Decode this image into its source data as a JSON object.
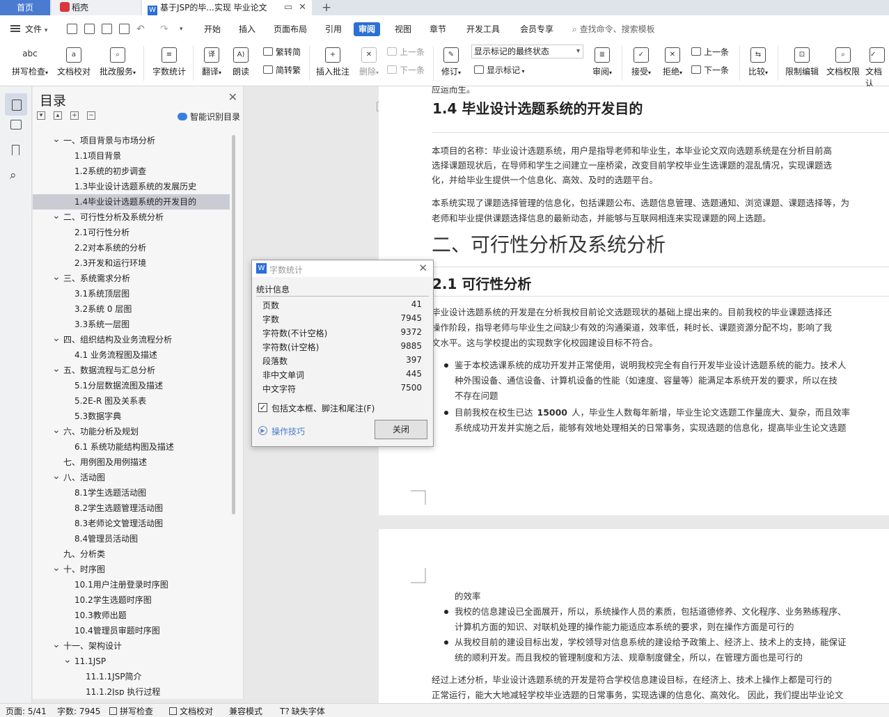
{
  "tabs": {
    "home": "首页",
    "daoke": "稻壳",
    "doc": "基于JSP的毕...实现 毕业论文",
    "add": "+"
  },
  "menu": {
    "file": "文件",
    "items": [
      "开始",
      "插入",
      "页面布局",
      "引用",
      "审阅",
      "视图",
      "章节",
      "开发工具",
      "会员专享"
    ],
    "active": "审阅",
    "search_placeholder": "查找命令、搜索模板"
  },
  "ribbon": {
    "spell_check": "拼写检查",
    "doc_proof": "文档校对",
    "revise_service": "批改服务",
    "word_count": "字数统计",
    "translate": "翻译",
    "read_aloud": "朗读",
    "trad_to_simp": "繁转简",
    "simp_to_trad": "简转繁",
    "insert_comment": "插入批注",
    "delete": "删除",
    "prev_comment": "上一条",
    "next_comment": "下一条",
    "track": "修订",
    "markup_mode": "显示标记的最终状态",
    "show_markup": "显示标记",
    "review": "审阅",
    "accept": "接受",
    "reject": "拒绝",
    "prev_change": "上一条",
    "next_change": "下一条",
    "compare": "比较",
    "restrict_edit": "限制编辑",
    "doc_permission": "文档权限",
    "doc_auth": "文档认"
  },
  "toc": {
    "title": "目录",
    "smart": "智能识别目录",
    "items": [
      {
        "label": "一、项目背景与市场分析",
        "level": 1,
        "caret": true
      },
      {
        "label": "1.1项目背景",
        "level": 2
      },
      {
        "label": "1.2系统的初步调查",
        "level": 2
      },
      {
        "label": "1.3毕业设计选题系统的发展历史",
        "level": 2
      },
      {
        "label": "1.4毕业设计选题系统的开发目的",
        "level": 2,
        "selected": true
      },
      {
        "label": "二、可行性分析及系统分析",
        "level": 1,
        "caret": true
      },
      {
        "label": "2.1可行性分析",
        "level": 2
      },
      {
        "label": "2.2对本系统的分析",
        "level": 2
      },
      {
        "label": "2.3开发和运行环境",
        "level": 2
      },
      {
        "label": "三、系统需求分析",
        "level": 1,
        "caret": true
      },
      {
        "label": "3.1系统顶层图",
        "level": 2
      },
      {
        "label": "3.2系统 0 层图",
        "level": 2
      },
      {
        "label": "3.3系统一层图",
        "level": 2
      },
      {
        "label": "四、组织结构及业务流程分析",
        "level": 1,
        "caret": true
      },
      {
        "label": "4.1 业务流程图及描述",
        "level": 2
      },
      {
        "label": "五、数据流程与汇总分析",
        "level": 1,
        "caret": true
      },
      {
        "label": "5.1分层数据流图及描述",
        "level": 2
      },
      {
        "label": "5.2E-R 图及关系表",
        "level": 2
      },
      {
        "label": "5.3数据字典",
        "level": 2
      },
      {
        "label": "六、功能分析及规划",
        "level": 1,
        "caret": true
      },
      {
        "label": "6.1 系统功能结构图及描述",
        "level": 2
      },
      {
        "label": "七、用例图及用例描述",
        "level": 1,
        "caret": false
      },
      {
        "label": "八、活动图",
        "level": 1,
        "caret": true
      },
      {
        "label": "8.1学生选题活动图",
        "level": 2
      },
      {
        "label": "8.2学生选题管理活动图",
        "level": 2
      },
      {
        "label": "8.3老师论文管理活动图",
        "level": 2
      },
      {
        "label": "8.4管理员活动图",
        "level": 2
      },
      {
        "label": "九、分析类",
        "level": 1,
        "caret": false
      },
      {
        "label": "十、时序图",
        "level": 1,
        "caret": true
      },
      {
        "label": "10.1用户注册登录时序图",
        "level": 2
      },
      {
        "label": "10.2学生选题时序图",
        "level": 2
      },
      {
        "label": "10.3教师出题",
        "level": 2
      },
      {
        "label": "10.4管理员审题时序图",
        "level": 2
      },
      {
        "label": "十一、架构设计",
        "level": 1,
        "caret": true
      },
      {
        "label": "11.1JSP",
        "level": 2,
        "caret": true
      },
      {
        "label": "11.1.1JSP简介",
        "level": 3
      },
      {
        "label": "11.1.2Jsp 执行过程",
        "level": 3
      }
    ]
  },
  "doc": {
    "top_fragment": "应运而生。",
    "h14": "1.4  毕业设计选题系统的开发目的",
    "p1_l1": "本项目的名称：毕业设计选题系统，用户是指导老师和毕业生，本毕业论文双向选题系统是在分析目前高",
    "p1_l2": "选择课题现状后，在导师和学生之间建立一座桥梁，改变目前学校毕业生选课题的混乱情况，实现课题选",
    "p1_l3": "化，并给毕业生提供一个信息化、高效、及时的选题平台。",
    "p2_l1": "本系统实现了课题选择管理的信息化，包括课题公布、选题信息管理、选题通知、浏览课题、课题选择等，为",
    "p2_l2": "老师和毕业提供课题选择信息的最新动态，并能够与互联网相连来实现课题的网上选题。",
    "h2": "二、可行性分析及系统分析",
    "h21": "2.1 可行性分析",
    "p3_l1": "毕业设计选题系统的开发是在分析我校目前论文选题现状的基础上提出来的。目前我校的毕业课题选择还",
    "p3_l2": "操作阶段，指导老师与毕业生之间缺少有效的沟通渠道，效率低，耗时长、课题资源分配不均，影响了我",
    "p3_l3": "文水平。这与学校提出的实现数字化校园建设目标不符合。",
    "b1_l1": "鉴于本校选课系统的成功开发并正常使用，说明我校完全有自行开发毕业设计选题系统的能力。技术人",
    "b1_l2": "种外围设备、通信设备、计算机设备的性能（如速度、容量等）能满足本系统开发的要求，所以在技",
    "b1_l3": "不存在问题",
    "b2_l1a": "目前我校在校生已达",
    "b2_num": "15000",
    "b2_l1b": "人，毕业生人数每年新增，毕业生论文选题工作量庞大、复杂，而且效率",
    "b2_l2": "系统成功开发并实施之后，能够有效地处理相关的日常事务，实现选题的信息化，提高毕业生论文选题",
    "p2b_l0": "的效率",
    "b3_l1": "我校的信息建设已全面展开，所以，系统操作人员的素质，包括道德修养、文化程序、业务熟练程序、",
    "b3_l2": "计算机方面的知识、对联机处理的操作能力能适应本系统的要求，则在操作方面是可行的",
    "b4_l1": "从我校目前的建设目标出发，学校领导对信息系统的建设给予政策上、经济上、技术上的支持，能保证",
    "b4_l2": "统的顺利开发。而且我校的管理制度和方法、规章制度健全，所以，在管理方面也是可行的",
    "p4_l1": "经过上述分析，毕业设计选题系统的开发是符合学校信息建设目标，在经济上、技术上操作上都是可行的",
    "p4_l2": "正常运行，能大大地减轻学校毕业选题的日常事务，实现选课的信息化、高效化。 因此，我们提出毕业论文"
  },
  "dialog": {
    "title": "字数统计",
    "section": "统计信息",
    "stats": [
      {
        "label": "页数",
        "value": "41"
      },
      {
        "label": "字数",
        "value": "7945"
      },
      {
        "label": "字符数(不计空格)",
        "value": "9372"
      },
      {
        "label": "字符数(计空格)",
        "value": "9885"
      },
      {
        "label": "段落数",
        "value": "397"
      },
      {
        "label": "非中文单词",
        "value": "445"
      },
      {
        "label": "中文字符",
        "value": "7500"
      }
    ],
    "include_label": "包括文本框、脚注和尾注(F)",
    "include_checked": true,
    "tips": "操作技巧",
    "close": "关闭"
  },
  "status": {
    "page": "页面: 5/41",
    "words": "字数: 7945",
    "spell": "拼写检查",
    "proof": "文档校对",
    "compat": "兼容模式",
    "missing_font": "缺失字体"
  },
  "colors": {
    "accent": "#2c6fd6",
    "tab_home": "#4a7bd1",
    "toc_selected": "#c9cdd3",
    "link": "#4a7bd1"
  }
}
